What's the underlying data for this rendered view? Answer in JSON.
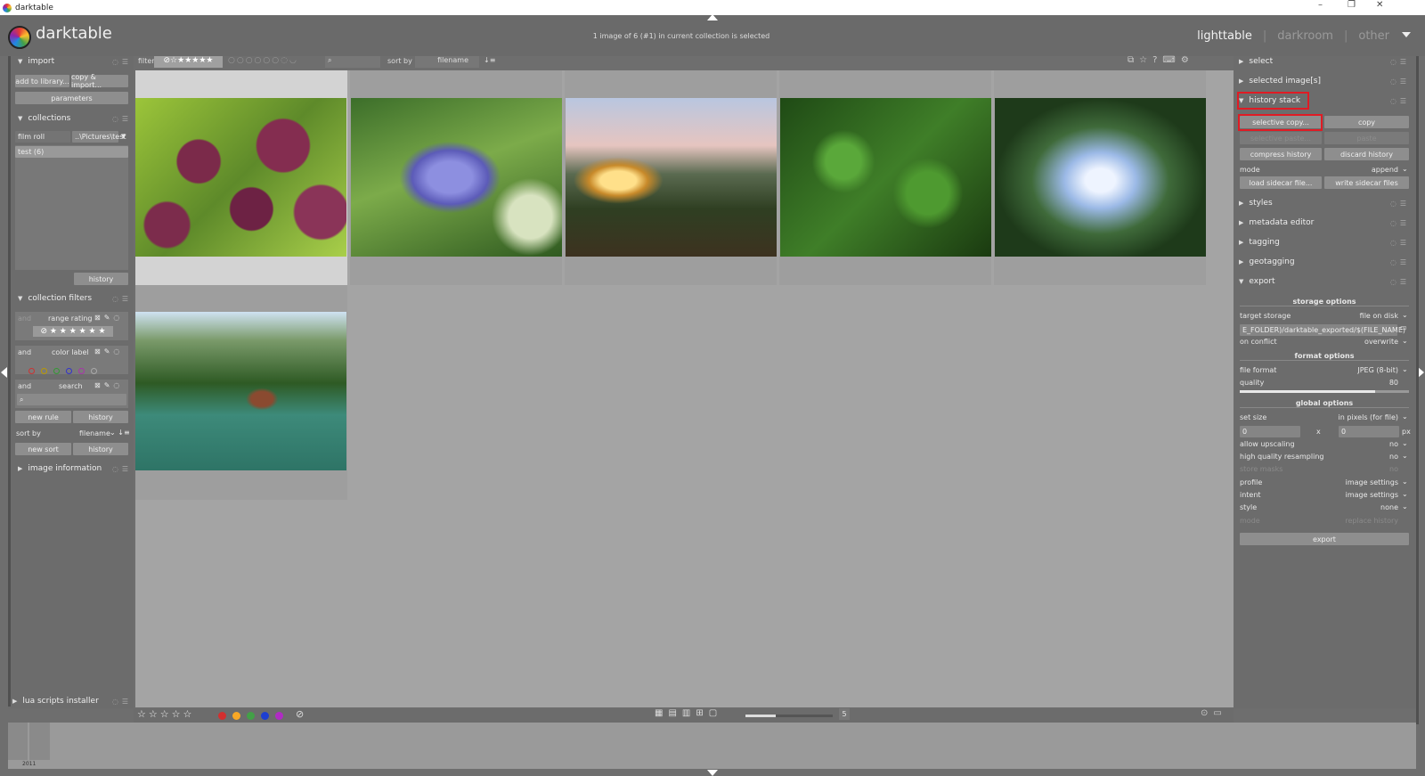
{
  "window": {
    "title": "darktable",
    "minimize": "–",
    "restore": "❐",
    "close": "✕"
  },
  "header": {
    "brand": "darktable",
    "selection_info": "1 image of 6 (#1) in current collection is selected",
    "views": {
      "lighttable": "lighttable",
      "darkroom": "darkroom",
      "other": "other",
      "sep": "|"
    }
  },
  "left": {
    "import": {
      "title": "import",
      "add": "add to library...",
      "copy": "copy & import...",
      "params": "parameters"
    },
    "collections": {
      "title": "collections",
      "type": "film roll",
      "path": "..\\Pictures\\test",
      "item": "test (6)",
      "history": "history"
    },
    "filters": {
      "title": "collection filters",
      "rule1_and": "and",
      "rule1": "range rating",
      "rule2_and": "and",
      "rule2": "color label",
      "rule3_and": "and",
      "rule3": "search",
      "new_rule": "new rule",
      "history": "history",
      "sort_by": "sort by",
      "sort_val": "filename",
      "new_sort": "new sort",
      "history2": "history"
    },
    "image_info": {
      "title": "image information"
    },
    "lua": {
      "title": "lua scripts installer"
    }
  },
  "topbar": {
    "filter": "filter",
    "sort_by": "sort by",
    "sort_val": "filename",
    "search_icon": "⌕"
  },
  "right": {
    "select": "select",
    "selected_images": "selected image[s]",
    "history_stack": "history stack",
    "selective_copy": "selective copy...",
    "copy": "copy",
    "selective_paste": "selective paste...",
    "paste": "paste",
    "compress": "compress history",
    "discard": "discard history",
    "mode": "mode",
    "mode_val": "append",
    "load_sidecar": "load sidecar file...",
    "write_sidecar": "write sidecar files",
    "styles": "styles",
    "metadata": "metadata editor",
    "tagging": "tagging",
    "geotagging": "geotagging",
    "export": "export",
    "storage_options": "storage options",
    "target_storage": "target storage",
    "target_val": "file on disk",
    "path": "E_FOLDER)/darktable_exported/$(FILE_NAME)",
    "on_conflict": "on conflict",
    "conflict_val": "overwrite",
    "format_options": "format options",
    "file_format": "file format",
    "format_val": "JPEG (8-bit)",
    "quality": "quality",
    "quality_val": "80",
    "quality_level": 0.8,
    "global_options": "global options",
    "set_size": "set size",
    "size_val": "in pixels (for file)",
    "w": "0",
    "x": "x",
    "h": "0",
    "px": "px",
    "upscaling": "allow upscaling",
    "upscaling_val": "no",
    "hq": "high quality resampling",
    "hq_val": "no",
    "masks": "store masks",
    "masks_val": "no",
    "profile": "profile",
    "profile_val": "image settings",
    "intent": "intent",
    "intent_val": "image settings",
    "style": "style",
    "style_val": "none",
    "mode2": "mode",
    "mode2_val": "replace history",
    "export_btn": "export"
  },
  "bottom": {
    "zoom": "5",
    "zoom_level": 0.35,
    "stars": [
      "☆",
      "☆",
      "☆",
      "☆",
      "☆"
    ],
    "colors": [
      "#d32f2f",
      "#f9a825",
      "#43a047",
      "#1e3fd1",
      "#b02bc4"
    ],
    "reject": "⊘"
  },
  "filmstrip": {
    "label": "2011"
  },
  "colors": {
    "highlight": "#e01b24",
    "panel": "#6c6c6c"
  }
}
